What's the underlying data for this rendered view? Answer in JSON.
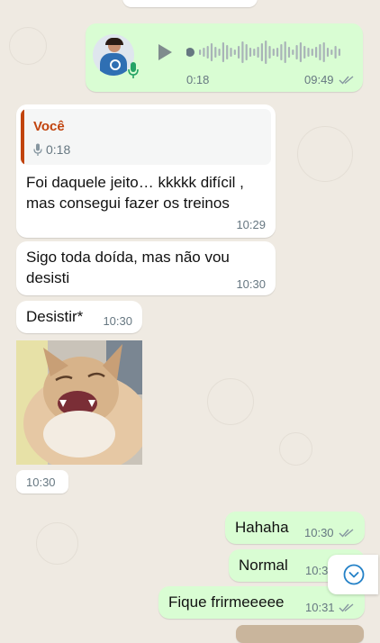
{
  "voice_message": {
    "duration": "0:18",
    "time": "09:49",
    "status_icon": "double-check-icon"
  },
  "messages": [
    {
      "reply_author": "Você",
      "reply_duration": "0:18",
      "text": "Foi daquele jeito… kkkkk difícil ,\nmas consegui fazer os treinos",
      "time": "10:29"
    },
    {
      "text": "Sigo toda doída, mas não vou\ndesisti",
      "time": "10:30"
    },
    {
      "text": "Desistir*",
      "time": "10:30"
    },
    {
      "image": "laughing-cat-photo",
      "time": "10:30"
    },
    {
      "text": "Hahaha",
      "time": "10:30"
    },
    {
      "text": "Normal",
      "time": "10:3"
    },
    {
      "text": "Fique frirmeeeee",
      "time": "10:31"
    }
  ],
  "colors": {
    "background": "#efeae2",
    "incoming_bubble": "#ffffff",
    "outgoing_bubble": "#d9fdd3",
    "reply_author": "#c1440e",
    "reply_bar": "#c1440e",
    "scroll_icon": "#2481c7"
  },
  "scroll_button_icon": "chevron-down-icon"
}
